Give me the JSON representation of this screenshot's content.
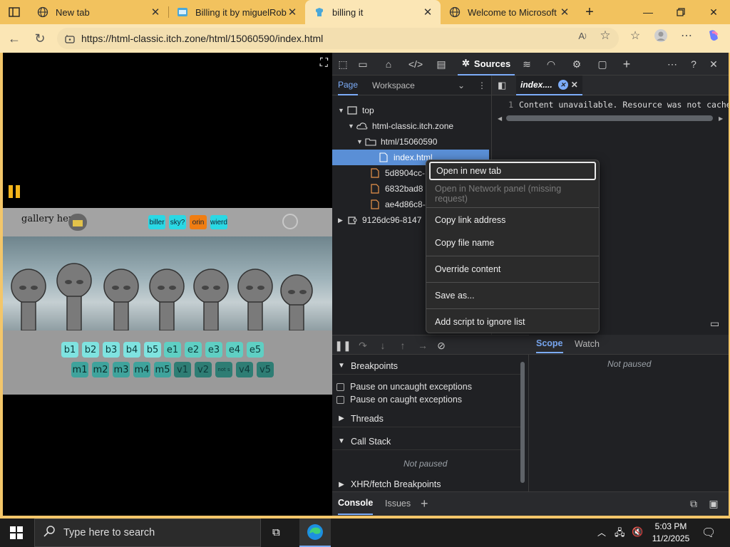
{
  "browser": {
    "tabs": [
      {
        "label": "New tab",
        "icon": "browser-tab-icon",
        "active": false
      },
      {
        "label": "Billing it by miguelRoblo",
        "icon": "itch-favicon",
        "active": false
      },
      {
        "label": "billing it",
        "icon": "itch-favicon",
        "active": true
      },
      {
        "label": "Welcome to Microsoft Ed",
        "icon": "edge-globe-icon",
        "active": false
      }
    ],
    "url": "https://html-classic.itch.zone/html/15060590/index.html"
  },
  "game": {
    "gallery_label": "gallery here",
    "top_buttons": [
      "biller",
      "sky?",
      "orin",
      "wierd"
    ],
    "row1": [
      "b1",
      "b2",
      "b3",
      "b4",
      "b5",
      "e1",
      "e2",
      "e3",
      "e4",
      "e5"
    ],
    "row2": [
      "m1",
      "m2",
      "m3",
      "m4",
      "m5",
      "v1",
      "v2",
      "not s",
      "v4",
      "v5"
    ]
  },
  "devtools": {
    "active_panel": "Sources",
    "nav_tabs": [
      "Page",
      "Workspace"
    ],
    "tree": {
      "top": "top",
      "domain": "html-classic.itch.zone",
      "folder": "html/15060590",
      "file_selected": "index.html",
      "files": [
        "5d8904cc-",
        "6832bad8",
        "ae4d86c8-"
      ],
      "other": "9126dc96-8147"
    },
    "editor": {
      "tab_label": "index....",
      "line_number": "1",
      "code": "Content unavailable. Resource was not cache"
    },
    "debugger": {
      "breakpoints": "Breakpoints",
      "pause_uncaught": "Pause on uncaught exceptions",
      "pause_caught": "Pause on caught exceptions",
      "threads": "Threads",
      "call_stack": "Call Stack",
      "not_paused": "Not paused",
      "xhr": "XHR/fetch Breakpoints",
      "scope": "Scope",
      "watch": "Watch"
    },
    "drawer": [
      "Console",
      "Issues"
    ]
  },
  "context_menu": {
    "items": [
      {
        "label": "Open in new tab",
        "enabled": true
      },
      {
        "label": "Open in Network panel (missing request)",
        "enabled": false
      },
      {
        "label": "Copy link address",
        "enabled": true
      },
      {
        "label": "Copy file name",
        "enabled": true
      },
      {
        "label": "Override content",
        "enabled": true
      },
      {
        "label": "Save as...",
        "enabled": true
      },
      {
        "label": "Add script to ignore list",
        "enabled": true
      }
    ]
  },
  "taskbar": {
    "search_placeholder": "Type here to search",
    "time": "5:03 PM",
    "date": "11/2/2025"
  }
}
